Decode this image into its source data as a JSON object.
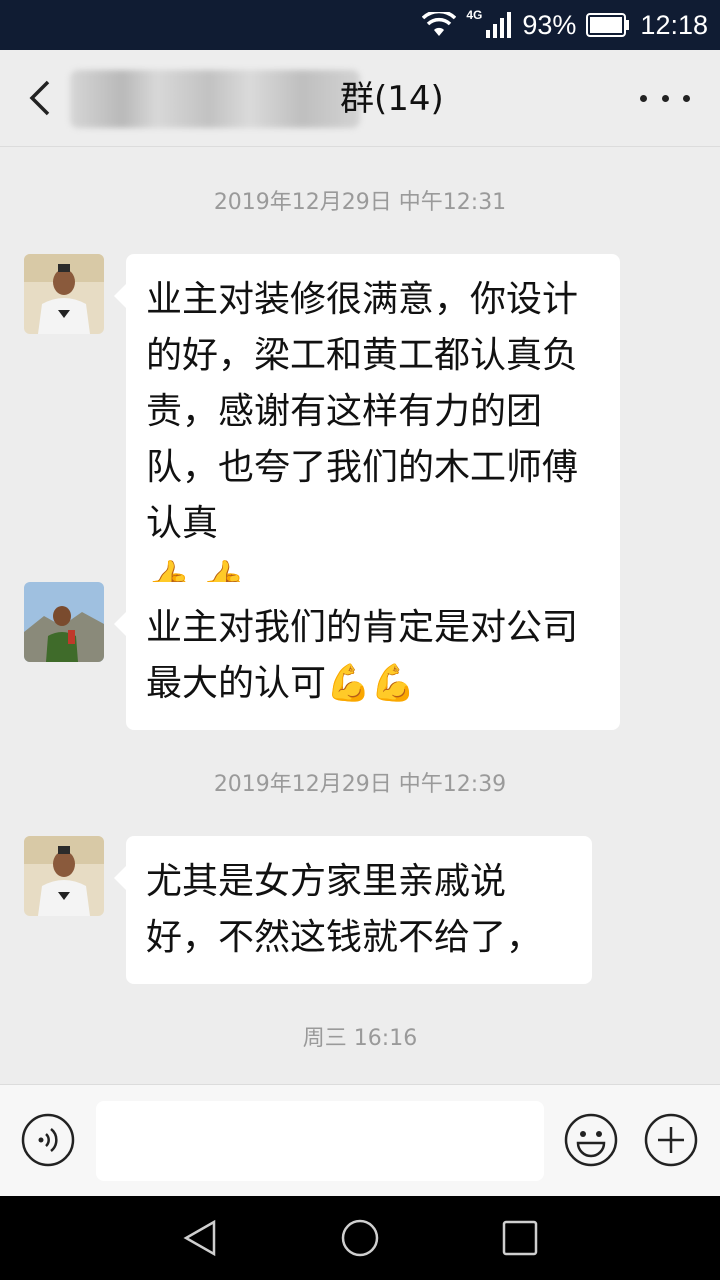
{
  "status_bar": {
    "network_type": "4G",
    "battery": "93%",
    "time": "12:18"
  },
  "header": {
    "title": "群(14)",
    "back_icon": "chevron-left-icon",
    "more_icon": "more-horizontal-icon"
  },
  "messages": [
    {
      "timestamp": "2019年12月29日 中午12:31"
    },
    {
      "text": "业主对装修很满意，你设计的好，梁工和黄工都认真负责，感谢有这样有力的团队，也夸了我们的木工师傅认真",
      "emojis": [
        "👍",
        "👍"
      ]
    },
    {
      "text": "业主对我们的肯定是对公司最大的认可",
      "emojis": [
        "💪",
        "💪"
      ]
    },
    {
      "timestamp": "2019年12月29日 中午12:39"
    },
    {
      "text": "尤其是女方家里亲戚说好，不然这钱就不给了，"
    },
    {
      "timestamp": "周三 16:16"
    }
  ],
  "input_bar": {
    "placeholder": "",
    "value": ""
  }
}
